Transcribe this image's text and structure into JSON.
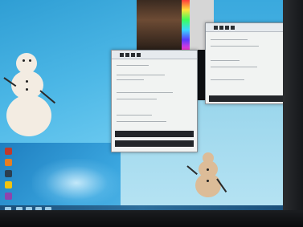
{
  "scene": "photo-of-monitor-with-windows",
  "desktop": {
    "wallpaper_accent": "#3aa6df"
  },
  "windows": [
    {
      "name": "window-left",
      "title_color": "#e6eaee",
      "footer_color": "#23262a"
    },
    {
      "name": "window-right",
      "title_color": "#e6eaee",
      "footer_color": "#23262a"
    }
  ],
  "icons": [
    "desktop-icon",
    "desktop-icon",
    "desktop-icon",
    "desktop-icon",
    "desktop-icon"
  ]
}
